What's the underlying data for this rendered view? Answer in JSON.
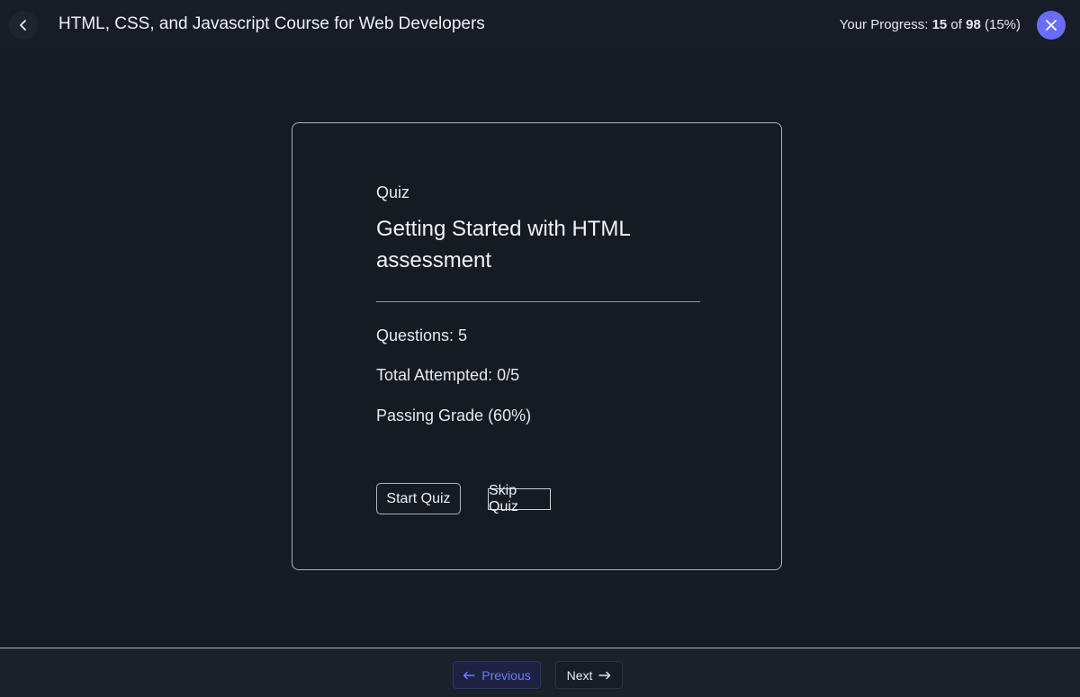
{
  "header": {
    "title": "HTML, CSS, and Javascript Course for Web Developers",
    "back_icon": "chevron-left-icon",
    "close_icon": "close-icon",
    "progress": {
      "prefix": "Your Progress: ",
      "current": "15",
      "sep": " of ",
      "total": "98",
      "percent": " (15%)"
    },
    "accent": "#6a6ef5"
  },
  "quiz": {
    "label": "Quiz",
    "title": "Getting Started with HTML assessment",
    "questions": "Questions: 5",
    "attempted": "Total Attempted: 0/5",
    "passing": "Passing Grade (60%)",
    "start_label": "Start Quiz",
    "skip_label": "Skip Quiz"
  },
  "footer": {
    "prev_label": "Previous",
    "next_label": "Next",
    "prev_icon": "arrow-left-icon",
    "next_icon": "arrow-right-icon"
  }
}
